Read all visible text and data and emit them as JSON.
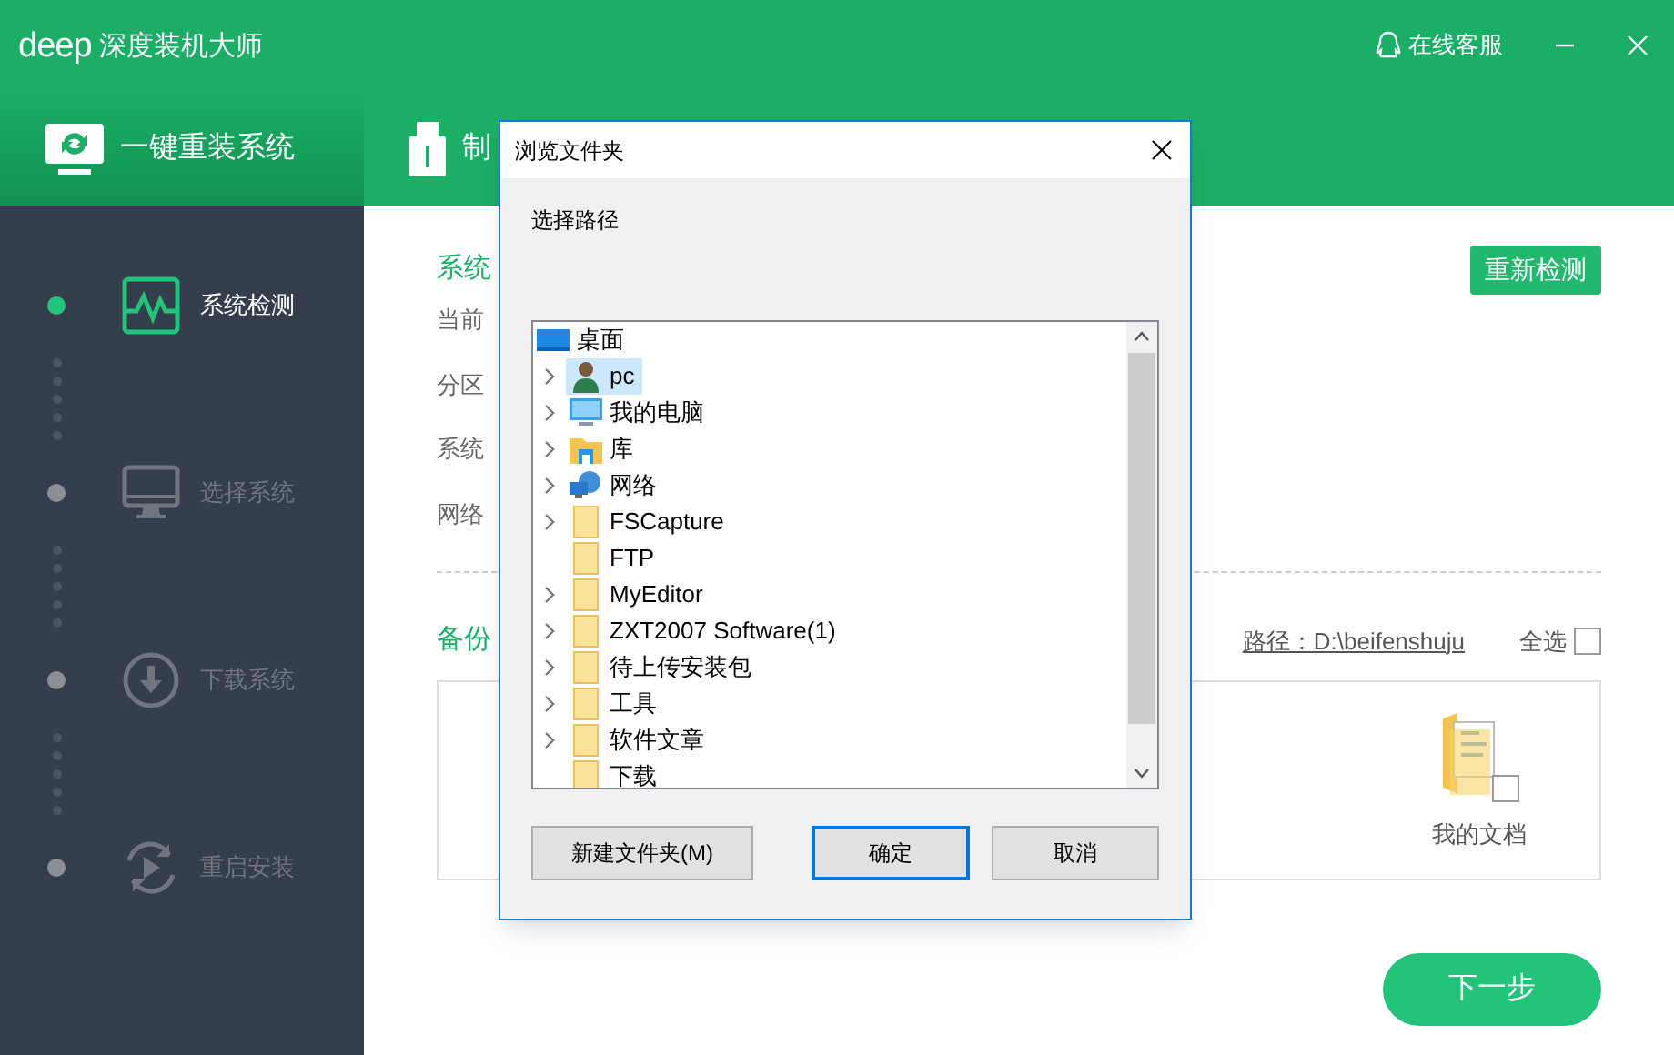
{
  "app": {
    "logo": "deep",
    "title": "深度装机大师",
    "support": "在线客服"
  },
  "tabs": [
    {
      "label": "一键重装系统",
      "selected": true,
      "kind": "reinstall"
    },
    {
      "label": "制",
      "selected": false,
      "kind": "usb"
    }
  ],
  "steps": [
    {
      "label": "系统检测",
      "selected": true,
      "kind": "detect"
    },
    {
      "label": "选择系统",
      "selected": false,
      "kind": "monitor"
    },
    {
      "label": "下载系统",
      "selected": false,
      "kind": "download"
    },
    {
      "label": "重启安装",
      "selected": false,
      "kind": "restart"
    }
  ],
  "content": {
    "section_title": "系统",
    "recheck_button": "重新检测",
    "info_labels": [
      "当前",
      "分区",
      "系统",
      "网络"
    ],
    "backup_title": "备份",
    "backup_path": "路径：D:\\beifenshuju",
    "select_all": "全选",
    "select_all_checked": false,
    "backup_items": [
      {
        "label": "我的文档",
        "checked": false
      }
    ],
    "next_button": "下一步"
  },
  "dialog": {
    "title": "浏览文件夹",
    "prompt": "选择路径",
    "tree": [
      {
        "label": "桌面",
        "kind": "desktop",
        "selected": false,
        "children": [
          {
            "label": "pc",
            "kind": "user",
            "expandable": true,
            "selected": true
          },
          {
            "label": "我的电脑",
            "kind": "computer",
            "expandable": true,
            "selected": false
          },
          {
            "label": "库",
            "kind": "library",
            "expandable": true,
            "selected": false
          },
          {
            "label": "网络",
            "kind": "network",
            "expandable": true,
            "selected": false
          },
          {
            "label": "FSCapture",
            "kind": "folder",
            "expandable": true,
            "selected": false
          },
          {
            "label": "FTP",
            "kind": "folder",
            "expandable": false,
            "selected": false
          },
          {
            "label": "MyEditor",
            "kind": "folder",
            "expandable": true,
            "selected": false
          },
          {
            "label": "ZXT2007 Software(1)",
            "kind": "folder",
            "expandable": true,
            "selected": false
          },
          {
            "label": "待上传安装包",
            "kind": "folder",
            "expandable": true,
            "selected": false
          },
          {
            "label": "工具",
            "kind": "folder",
            "expandable": true,
            "selected": false
          },
          {
            "label": "软件文章",
            "kind": "folder",
            "expandable": true,
            "selected": false
          },
          {
            "label": "下载",
            "kind": "folder",
            "expandable": false,
            "selected": false
          }
        ]
      }
    ],
    "buttons": [
      {
        "label": "新建文件夹(M)",
        "default": false
      },
      {
        "label": "确定",
        "default": true
      },
      {
        "label": "取消",
        "default": false
      }
    ]
  }
}
